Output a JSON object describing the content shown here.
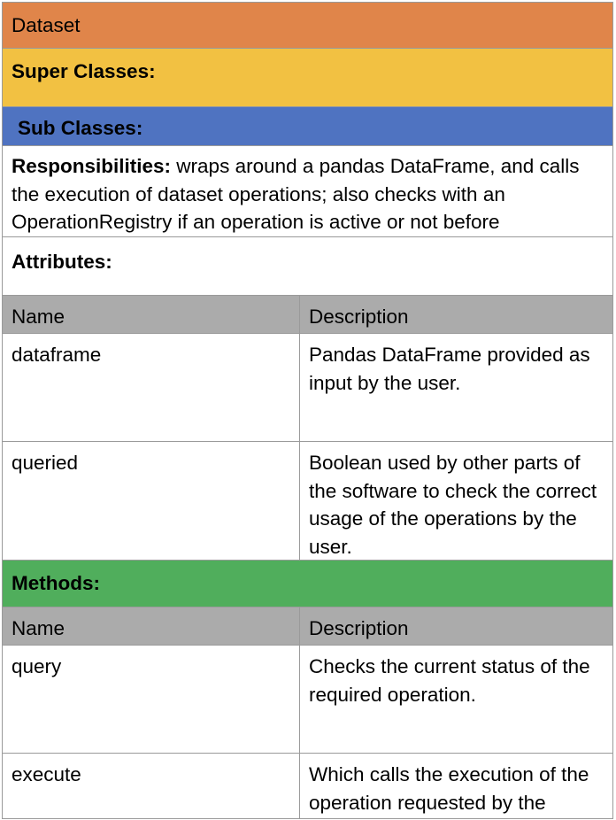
{
  "class_card": {
    "title": "Dataset",
    "super_classes_label": "Super Classes:",
    "sub_classes_label": "Sub Classes:",
    "responsibilities_label": "Responsibilities:",
    "responsibilities_text": " wraps around a pandas DataFrame, and calls the execution of dataset operations; also checks with an OperationRegistry if an operation is active or not before",
    "attributes_label": "Attributes:",
    "methods_label": "Methods:",
    "colors": {
      "title_bar": "#E0854A",
      "super_classes": "#F2C142",
      "sub_classes": "#4F73C1",
      "methods": "#50AE5C",
      "header_row": "#ABABAB",
      "border": "#9A9A9A"
    }
  },
  "attributes_table": {
    "headers": [
      "Name",
      "Description"
    ],
    "rows": [
      {
        "name": "dataframe",
        "description": "Pandas DataFrame provided as input by the user."
      },
      {
        "name": "queried",
        "description": "Boolean used by other parts of the software to check the correct usage of the operations by the user."
      }
    ]
  },
  "methods_table": {
    "headers": [
      "Name",
      "Description"
    ],
    "rows": [
      {
        "name": "query",
        "description": "Checks the current status of the required operation."
      },
      {
        "name": "execute",
        "description": "Which calls the execution of the operation requested by the"
      }
    ]
  }
}
